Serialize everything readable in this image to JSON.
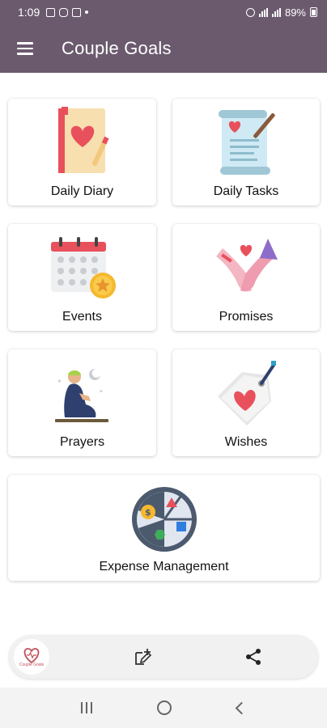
{
  "status_bar": {
    "time": "1:09",
    "battery": "89%"
  },
  "app_bar": {
    "title": "Couple Goals"
  },
  "cards": [
    {
      "label": "Daily Diary",
      "icon": "diary-icon"
    },
    {
      "label": "Daily Tasks",
      "icon": "tasks-scroll-icon"
    },
    {
      "label": "Events",
      "icon": "calendar-icon"
    },
    {
      "label": "Promises",
      "icon": "pinky-promise-icon"
    },
    {
      "label": "Prayers",
      "icon": "prayer-icon"
    },
    {
      "label": "Wishes",
      "icon": "wish-tag-icon"
    },
    {
      "label": "Expense Management",
      "icon": "expense-wheel-icon"
    }
  ],
  "toolbar": {
    "logo_text": "Couple Goals",
    "edit_icon": "edit-icon",
    "share_icon": "share-icon"
  },
  "colors": {
    "app_bar": "#6b5a6e",
    "heart": "#e8505b",
    "background": "#ffffff"
  }
}
